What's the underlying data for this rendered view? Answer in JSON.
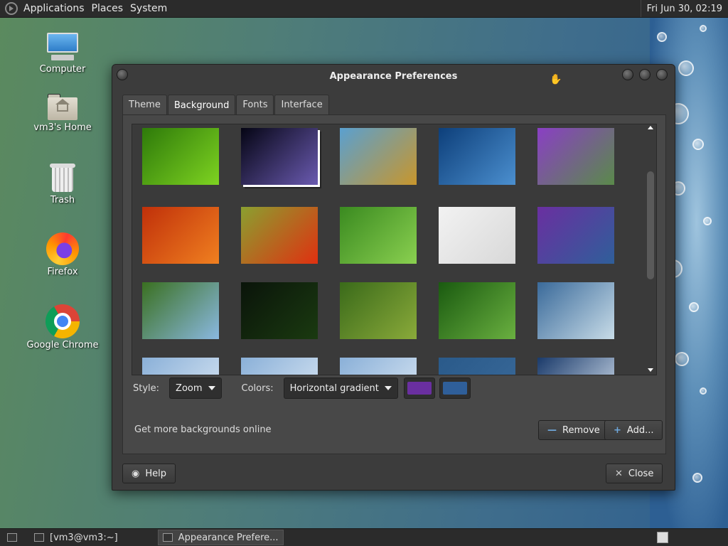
{
  "top_panel": {
    "menus": [
      "Applications",
      "Places",
      "System"
    ],
    "clock": "Fri Jun 30, 02:19"
  },
  "desktop_icons": [
    {
      "label": "Computer",
      "icon": "computer-icon"
    },
    {
      "label": "vm3's Home",
      "icon": "home-folder-icon"
    },
    {
      "label": "Trash",
      "icon": "trash-icon"
    },
    {
      "label": "Firefox",
      "icon": "firefox-icon"
    },
    {
      "label": "Google Chrome",
      "icon": "chrome-icon"
    }
  ],
  "window": {
    "title": "Appearance Preferences",
    "tabs": [
      "Theme",
      "Background",
      "Fonts",
      "Interface"
    ],
    "active_tab": "Background",
    "backgrounds": [
      {
        "name": "green-leaf",
        "colors": [
          "#2e7a0a",
          "#7ed321"
        ]
      },
      {
        "name": "comet",
        "colors": [
          "#050514",
          "#6a5ab0"
        ]
      },
      {
        "name": "grass-beach",
        "colors": [
          "#5aa0d0",
          "#c8962c"
        ]
      },
      {
        "name": "blue-abstract",
        "colors": [
          "#0d3f7a",
          "#4b8fcf"
        ]
      },
      {
        "name": "purple-gradient-dots",
        "colors": [
          "#8a3fc4",
          "#5a8a4a"
        ]
      },
      {
        "name": "orange-flower",
        "colors": [
          "#c0300a",
          "#f08020"
        ]
      },
      {
        "name": "red-flower",
        "colors": [
          "#8aa030",
          "#e03010"
        ]
      },
      {
        "name": "green-grass",
        "colors": [
          "#3a8a20",
          "#8ad050"
        ]
      },
      {
        "name": "mate-logo-light",
        "colors": [
          "#f2f2f2",
          "#d8d8d8"
        ]
      },
      {
        "name": "purple-blue-gradient",
        "colors": [
          "#6a2fa0",
          "#2f5f9a"
        ]
      },
      {
        "name": "bluebells",
        "colors": [
          "#3a7020",
          "#8ab8e0"
        ]
      },
      {
        "name": "mate-dark",
        "colors": [
          "#0a140a",
          "#1a3a10"
        ]
      },
      {
        "name": "mate-green",
        "colors": [
          "#3a6a1a",
          "#8aaa3a"
        ]
      },
      {
        "name": "green-leaves-drops",
        "colors": [
          "#1a5a10",
          "#6ab040"
        ]
      },
      {
        "name": "blue-waves",
        "colors": [
          "#3a6a9a",
          "#c8dce8"
        ]
      },
      {
        "name": "ice-1",
        "colors": [
          "#8ab0d8",
          "#dce8f4"
        ]
      },
      {
        "name": "ice-2",
        "colors": [
          "#8ab0d8",
          "#dce8f4"
        ]
      },
      {
        "name": "ice-3",
        "colors": [
          "#8ab0d8",
          "#dce8f4"
        ]
      },
      {
        "name": "blue-solid",
        "colors": [
          "#2a5a8a",
          "#3a6a9a"
        ]
      },
      {
        "name": "blue-swoosh",
        "colors": [
          "#1a3a6a",
          "#dce8f4"
        ]
      }
    ],
    "selected_background": "purple-blue-gradient",
    "style_label": "Style:",
    "style_value": "Zoom",
    "colors_label": "Colors:",
    "colors_value": "Horizontal gradient",
    "primary_color": "#6a2fa0",
    "secondary_color": "#2f5f9a",
    "more_link": "Get more backgrounds online",
    "remove_label": "Remove",
    "add_label": "Add...",
    "help_label": "Help",
    "close_label": "Close"
  },
  "taskbar": {
    "items": [
      "[vm3@vm3:~]",
      "Appearance Prefere..."
    ]
  }
}
